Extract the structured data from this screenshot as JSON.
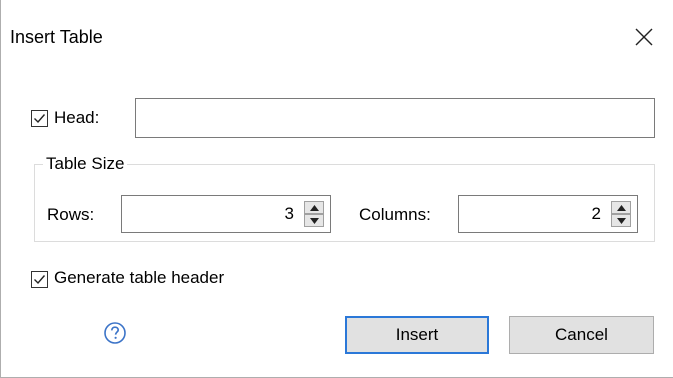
{
  "dialog": {
    "title": "Insert Table"
  },
  "head": {
    "checked": true,
    "label": "Head:",
    "value": ""
  },
  "table_size": {
    "legend": "Table Size",
    "rows_label": "Rows:",
    "rows_value": "3",
    "columns_label": "Columns:",
    "columns_value": "2"
  },
  "generate_header": {
    "checked": true,
    "label": "Generate table header"
  },
  "buttons": {
    "insert": "Insert",
    "cancel": "Cancel"
  },
  "icons": {
    "close": "close-icon",
    "help": "help-icon",
    "check": "checkmark-icon",
    "spin_up": "triangle-up-icon",
    "spin_down": "triangle-down-icon"
  },
  "colors": {
    "default_button_border": "#2b78d8",
    "help_icon": "#3c74c8"
  }
}
